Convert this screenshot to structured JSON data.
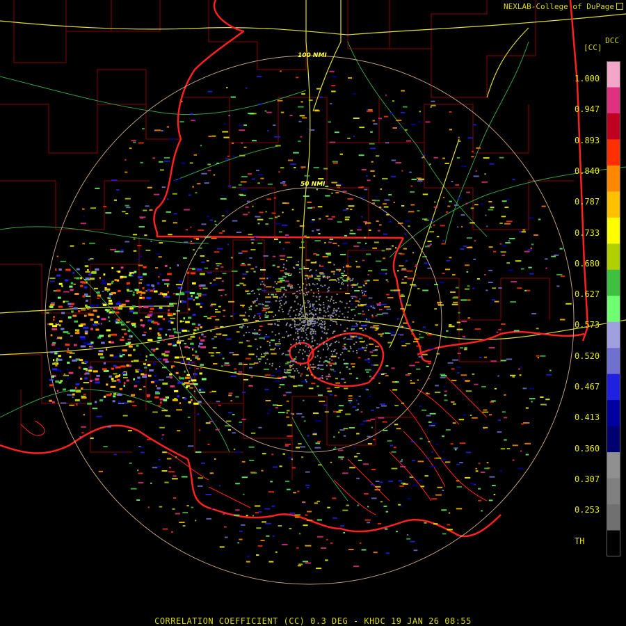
{
  "credit": "NEXLAB-College of DuPage",
  "product_code": "DCC",
  "unit_label": "[CC]",
  "footer": "CORRELATION COEFFICIENT (CC) 0.3 DEG - KHDC 19 JAN 26 08:55",
  "range_rings": [
    "50 NMI",
    "100 NMI"
  ],
  "legend": {
    "labels": [
      "1.000",
      "0.947",
      "0.893",
      "0.840",
      "0.787",
      "0.733",
      "0.680",
      "0.627",
      "0.573",
      "0.520",
      "0.467",
      "0.413",
      "0.360",
      "0.307",
      "0.253",
      "TH"
    ],
    "colors": [
      "#f4a6c8",
      "#e03080",
      "#c00020",
      "#ff3000",
      "#ff8800",
      "#ffc000",
      "#ffff00",
      "#b0d000",
      "#40c040",
      "#70ff70",
      "#a0a0e0",
      "#7070d0",
      "#2020e0",
      "#0000a0",
      "#000070",
      "#909090",
      "#808080",
      "#707070",
      "#000000"
    ]
  },
  "icons": [
    "external-link-icon"
  ]
}
